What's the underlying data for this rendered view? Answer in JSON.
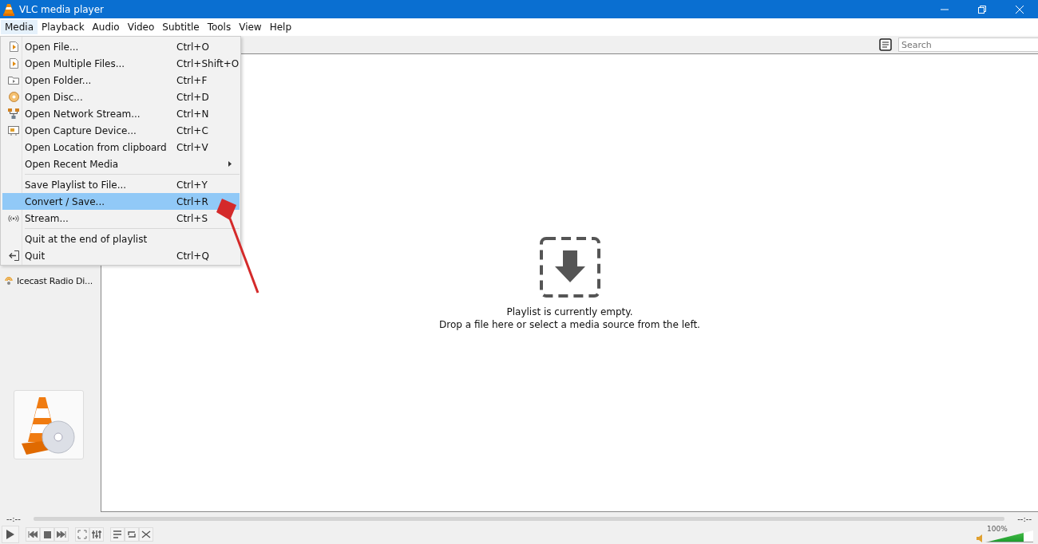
{
  "window": {
    "title": "VLC media player"
  },
  "menu_bar": [
    {
      "label": "Media",
      "selected": true
    },
    {
      "label": "Playback",
      "selected": false
    },
    {
      "label": "Audio",
      "selected": false
    },
    {
      "label": "Video",
      "selected": false
    },
    {
      "label": "Subtitle",
      "selected": false
    },
    {
      "label": "Tools",
      "selected": false
    },
    {
      "label": "View",
      "selected": false
    },
    {
      "label": "Help",
      "selected": false
    }
  ],
  "media_menu": [
    {
      "kind": "item",
      "label": "Open File...",
      "shortcut": "Ctrl+O",
      "selected": false
    },
    {
      "kind": "item",
      "label": "Open Multiple Files...",
      "shortcut": "Ctrl+Shift+O",
      "selected": false
    },
    {
      "kind": "item",
      "label": "Open Folder...",
      "shortcut": "Ctrl+F",
      "selected": false
    },
    {
      "kind": "item",
      "label": "Open Disc...",
      "shortcut": "Ctrl+D",
      "selected": false
    },
    {
      "kind": "item",
      "label": "Open Network Stream...",
      "shortcut": "Ctrl+N",
      "selected": false
    },
    {
      "kind": "item",
      "label": "Open Capture Device...",
      "shortcut": "Ctrl+C",
      "selected": false
    },
    {
      "kind": "item",
      "label": "Open Location from clipboard",
      "shortcut": "Ctrl+V",
      "selected": false
    },
    {
      "kind": "submenu",
      "label": "Open Recent Media",
      "selected": false
    },
    {
      "kind": "separator"
    },
    {
      "kind": "item",
      "label": "Save Playlist to File...",
      "shortcut": "Ctrl+Y",
      "selected": false
    },
    {
      "kind": "item",
      "label": "Convert / Save...",
      "shortcut": "Ctrl+R",
      "selected": true
    },
    {
      "kind": "item",
      "label": "Stream...",
      "shortcut": "Ctrl+S",
      "selected": false
    },
    {
      "kind": "separator"
    },
    {
      "kind": "item",
      "label": "Quit at the end of playlist",
      "selected": false
    },
    {
      "kind": "item",
      "label": "Quit",
      "shortcut": "Ctrl+Q",
      "selected": false
    }
  ],
  "sidebar": {
    "items": [
      {
        "label": "Icecast Radio Di..."
      }
    ]
  },
  "search": {
    "placeholder": "Search"
  },
  "playlist": {
    "empty_title": "Playlist is currently empty.",
    "empty_hint": "Drop a file here or select a media source from the left."
  },
  "seek": {
    "elapsed": "--:--",
    "remaining": "--:--",
    "level": 0
  },
  "volume": {
    "reading": "100%",
    "level": 0.8
  }
}
